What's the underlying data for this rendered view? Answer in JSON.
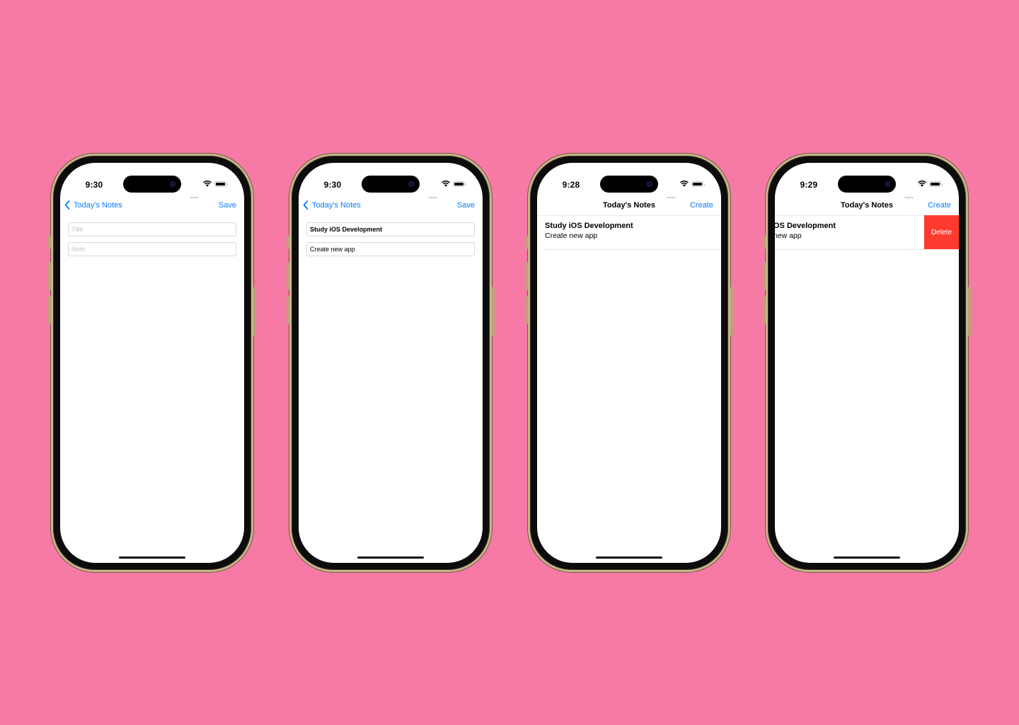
{
  "screens": [
    {
      "time": "9:30",
      "nav": {
        "back_label": "Today's Notes",
        "right_label": "Save"
      },
      "form": {
        "title_placeholder": "Title",
        "note_placeholder": "Note",
        "title_value": "",
        "note_value": ""
      }
    },
    {
      "time": "9:30",
      "nav": {
        "back_label": "Today's Notes",
        "right_label": "Save"
      },
      "form": {
        "title_placeholder": "Title",
        "note_placeholder": "Note",
        "title_value": "Study iOS Development",
        "note_value": "Create new app"
      }
    },
    {
      "time": "9:28",
      "nav": {
        "title": "Today's Notes",
        "right_label": "Create"
      },
      "notes": [
        {
          "title": "Study iOS Development",
          "body": "Create new app"
        }
      ]
    },
    {
      "time": "9:29",
      "nav": {
        "title": "Today's Notes",
        "right_label": "Create"
      },
      "notes": [
        {
          "title": "OS Development",
          "body": "new app"
        }
      ],
      "swipe_action": {
        "label": "Delete",
        "color": "#FF3B30"
      }
    }
  ],
  "colors": {
    "background": "#F779A6",
    "accent": "#0A7AFF",
    "destructive": "#FF3B30"
  }
}
